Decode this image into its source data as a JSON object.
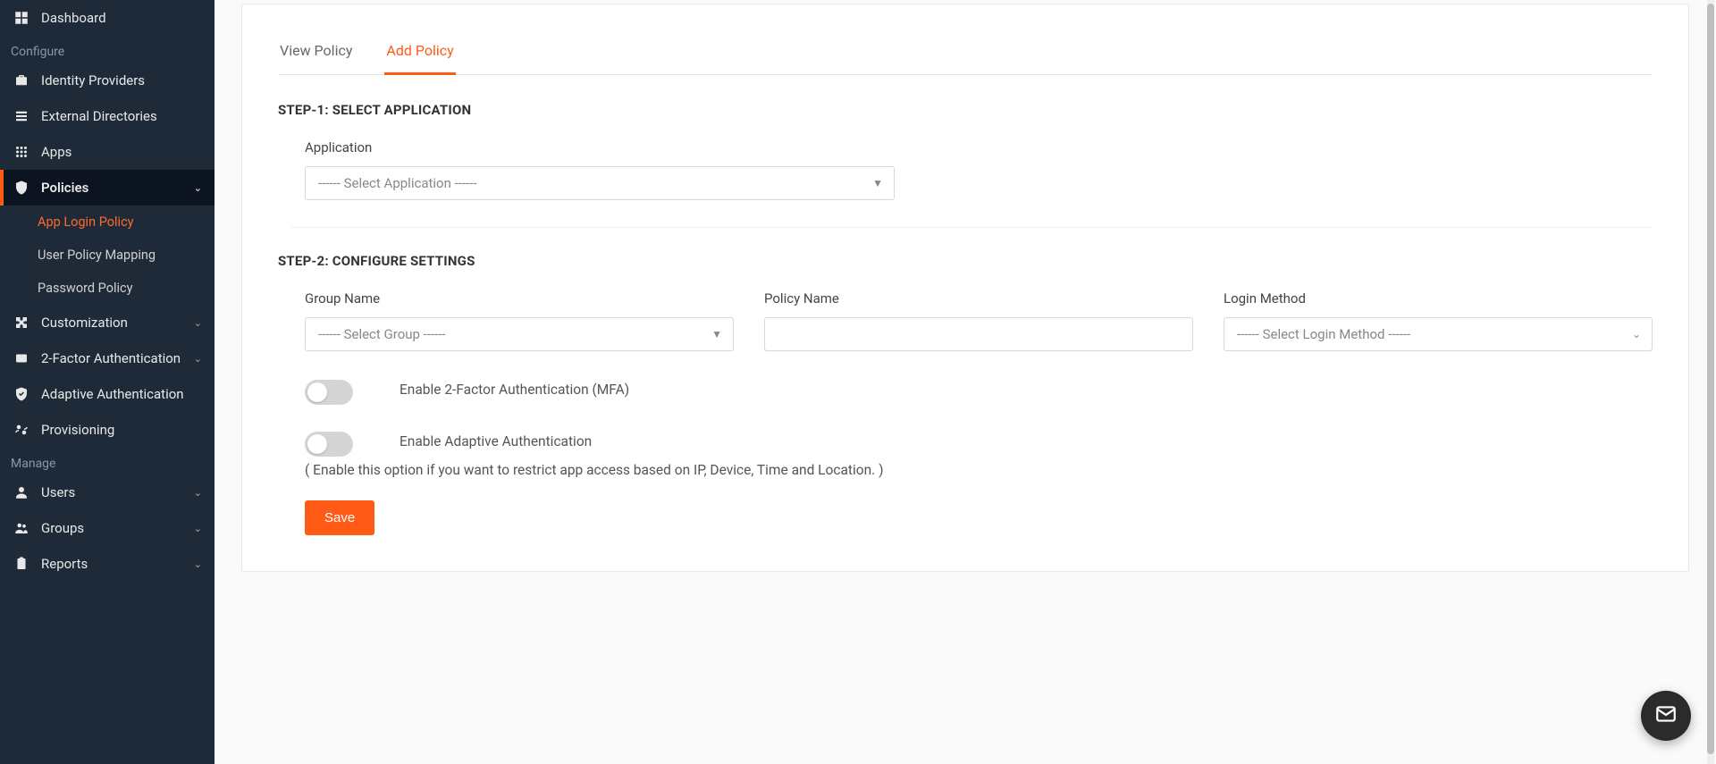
{
  "sidebar": {
    "sections": {
      "configure": "Configure",
      "manage": "Manage"
    },
    "dashboard": "Dashboard",
    "identity_providers": "Identity Providers",
    "external_directories": "External Directories",
    "apps": "Apps",
    "policies": "Policies",
    "policies_children": {
      "app_login_policy": "App Login Policy",
      "user_policy_mapping": "User Policy Mapping",
      "password_policy": "Password Policy"
    },
    "customization": "Customization",
    "two_factor": "2-Factor Authentication",
    "adaptive_auth": "Adaptive Authentication",
    "provisioning": "Provisioning",
    "users": "Users",
    "groups": "Groups",
    "reports": "Reports"
  },
  "tabs": {
    "view_policy": "View Policy",
    "add_policy": "Add Policy"
  },
  "step1": {
    "title": "STEP-1: SELECT APPLICATION",
    "application_label": "Application",
    "application_placeholder": "------ Select Application ------"
  },
  "step2": {
    "title": "STEP-2: CONFIGURE SETTINGS",
    "group_label": "Group Name",
    "group_placeholder": "------ Select Group ------",
    "policy_label": "Policy Name",
    "policy_value": "",
    "login_method_label": "Login Method",
    "login_method_placeholder": "------ Select Login Method ------",
    "mfa_label": "Enable 2-Factor Authentication (MFA)",
    "adaptive_label": "Enable Adaptive Authentication",
    "adaptive_note": "( Enable this option if you want to restrict app access based on IP, Device, Time and Location. )"
  },
  "buttons": {
    "save": "Save"
  }
}
